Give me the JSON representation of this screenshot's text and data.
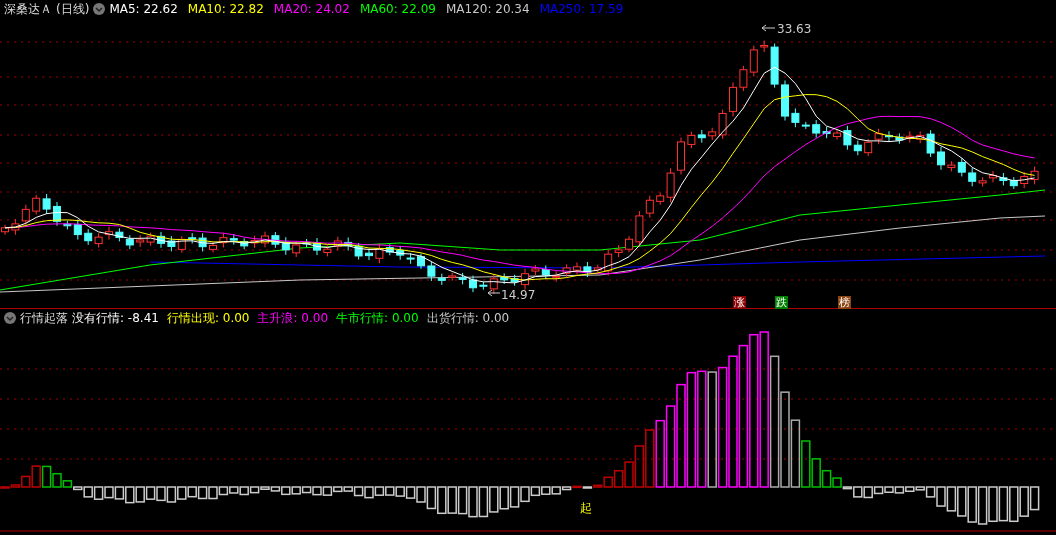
{
  "header": {
    "title": "深桑达Ａ",
    "period": "(日线)",
    "ma": [
      {
        "label": "MA5: 22.62",
        "color": "#ffffff"
      },
      {
        "label": "MA10: 22.82",
        "color": "#ffff00"
      },
      {
        "label": "MA20: 24.02",
        "color": "#ff00ff"
      },
      {
        "label": "MA60: 22.09",
        "color": "#00ff00"
      },
      {
        "label": "MA120: 20.34",
        "color": "#c8c8c8"
      },
      {
        "label": "MA250: 17.59",
        "color": "#0000ff"
      }
    ]
  },
  "price_marks": {
    "high": "33.63",
    "low": "14.97"
  },
  "signals": [
    {
      "text": "涨",
      "color": "#8b0000"
    },
    {
      "text": "跌",
      "color": "#008000"
    },
    {
      "text": "榜",
      "color": "#8b4513"
    }
  ],
  "indicator": {
    "title": "行情起落",
    "items": [
      {
        "label": "没有行情: -8.41",
        "color": "#ffffff"
      },
      {
        "label": "行情出现: 0.00",
        "color": "#ffff00"
      },
      {
        "label": "主升浪: 0.00",
        "color": "#ff00ff"
      },
      {
        "label": "牛市行情: 0.00",
        "color": "#00ff00"
      },
      {
        "label": "出货行情: 0.00",
        "color": "#c8c8c8"
      }
    ],
    "start_mark": "起"
  }
}
